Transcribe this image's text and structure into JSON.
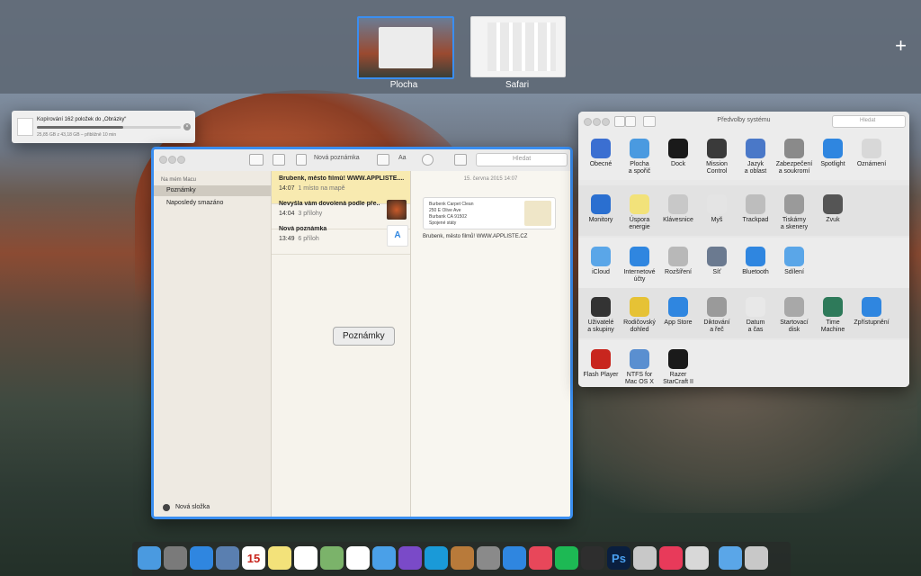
{
  "mission_control": {
    "spaces": [
      {
        "label": "Plocha"
      },
      {
        "label": "Safari"
      }
    ],
    "add_space": "+"
  },
  "copy_dialog": {
    "title": "Kopírování 162 položek do „Obrázky“",
    "detail": "25,85 GB z 43,18 GB – přibližně 10 min",
    "progress": 0.6
  },
  "notes_window": {
    "search_placeholder": "Hledat",
    "new_note_toolbar": "Nová poznámka",
    "aa": "Aa",
    "sidebar_section": "Na mém Macu",
    "folders": [
      "Poznámky",
      "Naposledy smazáno"
    ],
    "new_folder": "Nová složka",
    "notes": [
      {
        "title": "Brubenk, město filmů! WWW.APPLISTE....",
        "time": "14:07",
        "meta": "1 místo na mapě"
      },
      {
        "title": "Nevyšla vám dovolená podle pře...",
        "time": "14:04",
        "meta": "3 přílohy"
      },
      {
        "title": "Nová poznámka",
        "time": "13:49",
        "meta": "6 příloh"
      }
    ],
    "date": "15. června 2015 14:07",
    "map_card": [
      "Burbenk Carpet Clean",
      "250 E Olive Ave",
      "Burbank CA 91502",
      "Spojené státy"
    ],
    "body_text": "Brubenk, město filmů! WWW.APPLISTE.CZ",
    "window_label": "Poznámky"
  },
  "prefs_window": {
    "title": "Předvolby systému",
    "search_placeholder": "Hledat",
    "rows": [
      [
        {
          "label": "Obecné",
          "icon": "general-icon",
          "color": "#3b6fd1"
        },
        {
          "label": "Plocha\na spořič",
          "icon": "desktop-icon",
          "color": "#4a9ae0"
        },
        {
          "label": "Dock",
          "icon": "dock-icon",
          "color": "#1a1a1a"
        },
        {
          "label": "Mission\nControl",
          "icon": "mission-control-icon",
          "color": "#3a3a3a"
        },
        {
          "label": "Jazyk\na oblast",
          "icon": "language-icon",
          "color": "#4a78c8"
        },
        {
          "label": "Zabezpečení\na soukromí",
          "icon": "security-icon",
          "color": "#8a8a8a"
        },
        {
          "label": "Spotlight",
          "icon": "spotlight-icon",
          "color": "#2f86e0"
        },
        {
          "label": "Oznámení",
          "icon": "notifications-icon",
          "color": "#d8d8d8"
        }
      ],
      [
        {
          "label": "Monitory",
          "icon": "displays-icon",
          "color": "#2a6fd0"
        },
        {
          "label": "Úspora\nenergie",
          "icon": "energy-icon",
          "color": "#f2e27a"
        },
        {
          "label": "Klávesnice",
          "icon": "keyboard-icon",
          "color": "#c8c8c8"
        },
        {
          "label": "Myš",
          "icon": "mouse-icon",
          "color": "#e4e4e4"
        },
        {
          "label": "Trackpad",
          "icon": "trackpad-icon",
          "color": "#bdbdbd"
        },
        {
          "label": "Tiskárny\na skenery",
          "icon": "printer-icon",
          "color": "#9a9a9a"
        },
        {
          "label": "Zvuk",
          "icon": "sound-icon",
          "color": "#555555"
        }
      ],
      [
        {
          "label": "iCloud",
          "icon": "icloud-icon",
          "color": "#5aa6e8"
        },
        {
          "label": "Internetové\núčty",
          "icon": "internet-accounts-icon",
          "color": "#2f86e0"
        },
        {
          "label": "Rozšíření",
          "icon": "extensions-icon",
          "color": "#b8b8b8"
        },
        {
          "label": "Síť",
          "icon": "network-icon",
          "color": "#6b7a90"
        },
        {
          "label": "Bluetooth",
          "icon": "bluetooth-icon",
          "color": "#2f86e0"
        },
        {
          "label": "Sdílení",
          "icon": "sharing-icon",
          "color": "#5aa6e8"
        }
      ],
      [
        {
          "label": "Uživatelé\na skupiny",
          "icon": "users-icon",
          "color": "#333333"
        },
        {
          "label": "Rodičovský\ndohled",
          "icon": "parental-icon",
          "color": "#e6c235"
        },
        {
          "label": "App Store",
          "icon": "app-store-icon",
          "color": "#2f86e0"
        },
        {
          "label": "Diktování\na řeč",
          "icon": "dictation-icon",
          "color": "#9a9a9a"
        },
        {
          "label": "Datum\na čas",
          "icon": "date-time-icon",
          "color": "#e8e8e8"
        },
        {
          "label": "Startovací\ndisk",
          "icon": "startup-disk-icon",
          "color": "#a8a8a8"
        },
        {
          "label": "Time\nMachine",
          "icon": "time-machine-icon",
          "color": "#2e7a5a"
        },
        {
          "label": "Zpřístupnění",
          "icon": "accessibility-icon",
          "color": "#2f86e0"
        }
      ],
      [
        {
          "label": "Flash Player",
          "icon": "flash-icon",
          "color": "#c8261e"
        },
        {
          "label": "NTFS for\nMac OS X",
          "icon": "ntfs-icon",
          "color": "#5a8fd0"
        },
        {
          "label": "Razer\nStarCraft II",
          "icon": "razer-icon",
          "color": "#1a1a1a"
        }
      ]
    ]
  },
  "dock": {
    "items": [
      {
        "icon": "finder-icon",
        "color": "#4a9ae0"
      },
      {
        "icon": "launchpad-icon",
        "color": "#7a7a7a"
      },
      {
        "icon": "safari-icon",
        "color": "#2f86e0"
      },
      {
        "icon": "preview-icon",
        "color": "#5a7fb0"
      },
      {
        "icon": "calendar-icon",
        "color": "#ffffff",
        "text": "15"
      },
      {
        "icon": "notes-icon",
        "color": "#f3e27a"
      },
      {
        "icon": "reminders-icon",
        "color": "#ffffff"
      },
      {
        "icon": "maps-icon",
        "color": "#7bb36a"
      },
      {
        "icon": "photos-icon",
        "color": "#ffffff"
      },
      {
        "icon": "messages-icon",
        "color": "#4aa0e8"
      },
      {
        "icon": "scrivener-icon",
        "color": "#7a4ac8"
      },
      {
        "icon": "skype-icon",
        "color": "#1a9ad8"
      },
      {
        "icon": "ibooks-icon",
        "color": "#b87a3a"
      },
      {
        "icon": "system-preferences-icon",
        "color": "#8a8a8a"
      },
      {
        "icon": "app-store-dock-icon",
        "color": "#2f86e0"
      },
      {
        "icon": "itunes-icon",
        "color": "#e8475a"
      },
      {
        "icon": "spotify-icon",
        "color": "#1db954"
      },
      {
        "icon": "evernote-icon",
        "color": "#2e2e2e"
      },
      {
        "icon": "photoshop-icon",
        "color": "#0a1f3f",
        "text": "Ps"
      },
      {
        "icon": "disk-utility-icon",
        "color": "#c8c8c8"
      },
      {
        "icon": "lips-icon",
        "color": "#e83a5a"
      },
      {
        "icon": "utility-icon",
        "color": "#d8d8d8"
      },
      {
        "icon": "folder-icon",
        "color": "#5aa6e8"
      },
      {
        "icon": "trash-icon",
        "color": "#c8c8c8"
      }
    ]
  }
}
